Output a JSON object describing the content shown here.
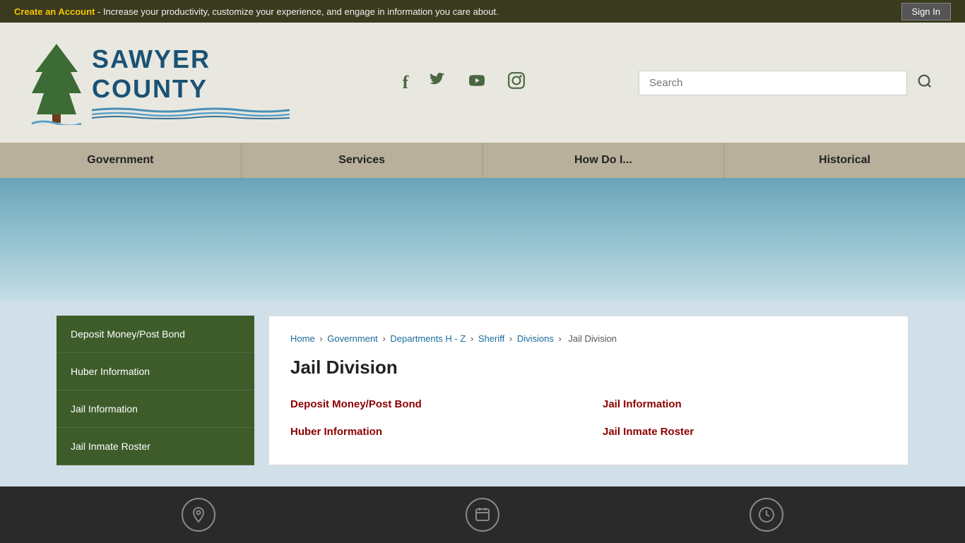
{
  "topbar": {
    "cta_link": "Create an Account",
    "cta_text": " - Increase your productivity, customize your experience, and engage in information you care about.",
    "sign_in": "Sign In"
  },
  "header": {
    "logo_name_line1": "SAWYER",
    "logo_name_line2": "COUNTY",
    "search_placeholder": "Search",
    "search_btn_label": "🔍"
  },
  "social": {
    "facebook": "f",
    "twitter": "🐦",
    "youtube": "▶",
    "instagram": "📷"
  },
  "nav": {
    "items": [
      {
        "label": "Government"
      },
      {
        "label": "Services"
      },
      {
        "label": "How Do I..."
      },
      {
        "label": "Historical"
      }
    ]
  },
  "breadcrumb": {
    "items": [
      {
        "label": "Home",
        "href": "#"
      },
      {
        "label": "Government",
        "href": "#"
      },
      {
        "label": "Departments H - Z",
        "href": "#"
      },
      {
        "label": "Sheriff",
        "href": "#"
      },
      {
        "label": "Divisions",
        "href": "#"
      }
    ],
    "current": "Jail Division"
  },
  "sidebar": {
    "items": [
      {
        "label": "Deposit Money/Post Bond"
      },
      {
        "label": "Huber Information"
      },
      {
        "label": "Jail Information"
      },
      {
        "label": "Jail Inmate Roster"
      }
    ]
  },
  "content": {
    "title": "Jail Division",
    "links": [
      {
        "label": "Deposit Money/Post Bond"
      },
      {
        "label": "Jail Information"
      },
      {
        "label": "Huber Information"
      },
      {
        "label": "Jail Inmate Roster"
      }
    ]
  }
}
